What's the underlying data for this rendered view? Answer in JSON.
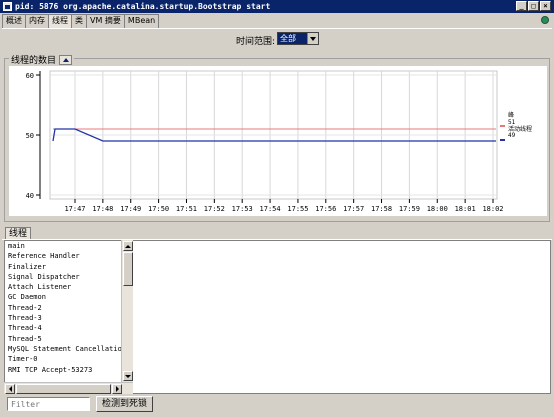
{
  "window": {
    "title": "pid: 5876 org.apache.catalina.startup.Bootstrap start",
    "buttons": [
      "_",
      "□",
      "×"
    ]
  },
  "tabs": [
    "概述",
    "内存",
    "线程",
    "类",
    "VM 摘要",
    "MBean"
  ],
  "active_tab": 2,
  "time_range": {
    "label": "时间范围:",
    "value": "全部"
  },
  "chart_panel": {
    "title": "线程的数目"
  },
  "chart_data": {
    "type": "line",
    "x": [
      "17:47",
      "17:48",
      "17:49",
      "17:50",
      "17:51",
      "17:52",
      "17:53",
      "17:54",
      "17:55",
      "17:56",
      "17:57",
      "17:58",
      "17:59",
      "18:00",
      "18:01",
      "18:02"
    ],
    "yticks": [
      "60",
      "50",
      "40"
    ],
    "ylim": [
      40,
      60
    ],
    "grid": true,
    "legend_position": "right",
    "series": [
      {
        "name": "峰",
        "color": "#e87878",
        "values": [
          51,
          51,
          51,
          51,
          51,
          51,
          51,
          51,
          51,
          51,
          51,
          51,
          51,
          51,
          51,
          51
        ]
      },
      {
        "name": "活动线程",
        "color": "#2233aa",
        "values": [
          51,
          49,
          49,
          49,
          49,
          49,
          49,
          49,
          49,
          49,
          49,
          49,
          49,
          49,
          49,
          49
        ]
      }
    ],
    "legend": [
      {
        "label": "峰",
        "value": ""
      },
      {
        "label": "51",
        "value": ""
      },
      {
        "label": "活动线程",
        "value": ""
      },
      {
        "label": "49",
        "value": ""
      }
    ]
  },
  "lower_tab": "线程",
  "threads": [
    "main",
    "Reference Handler",
    "Finalizer",
    "Signal Dispatcher",
    "Attach Listener",
    "GC Daemon",
    "Thread-2",
    "Thread-3",
    "Thread-4",
    "Thread-5",
    "MySQL Statement Cancellation T",
    "Timer-0",
    "RMI TCP Accept-53273"
  ],
  "filter": {
    "placeholder": "Filter"
  },
  "deadlock_button": "检测到死锁"
}
